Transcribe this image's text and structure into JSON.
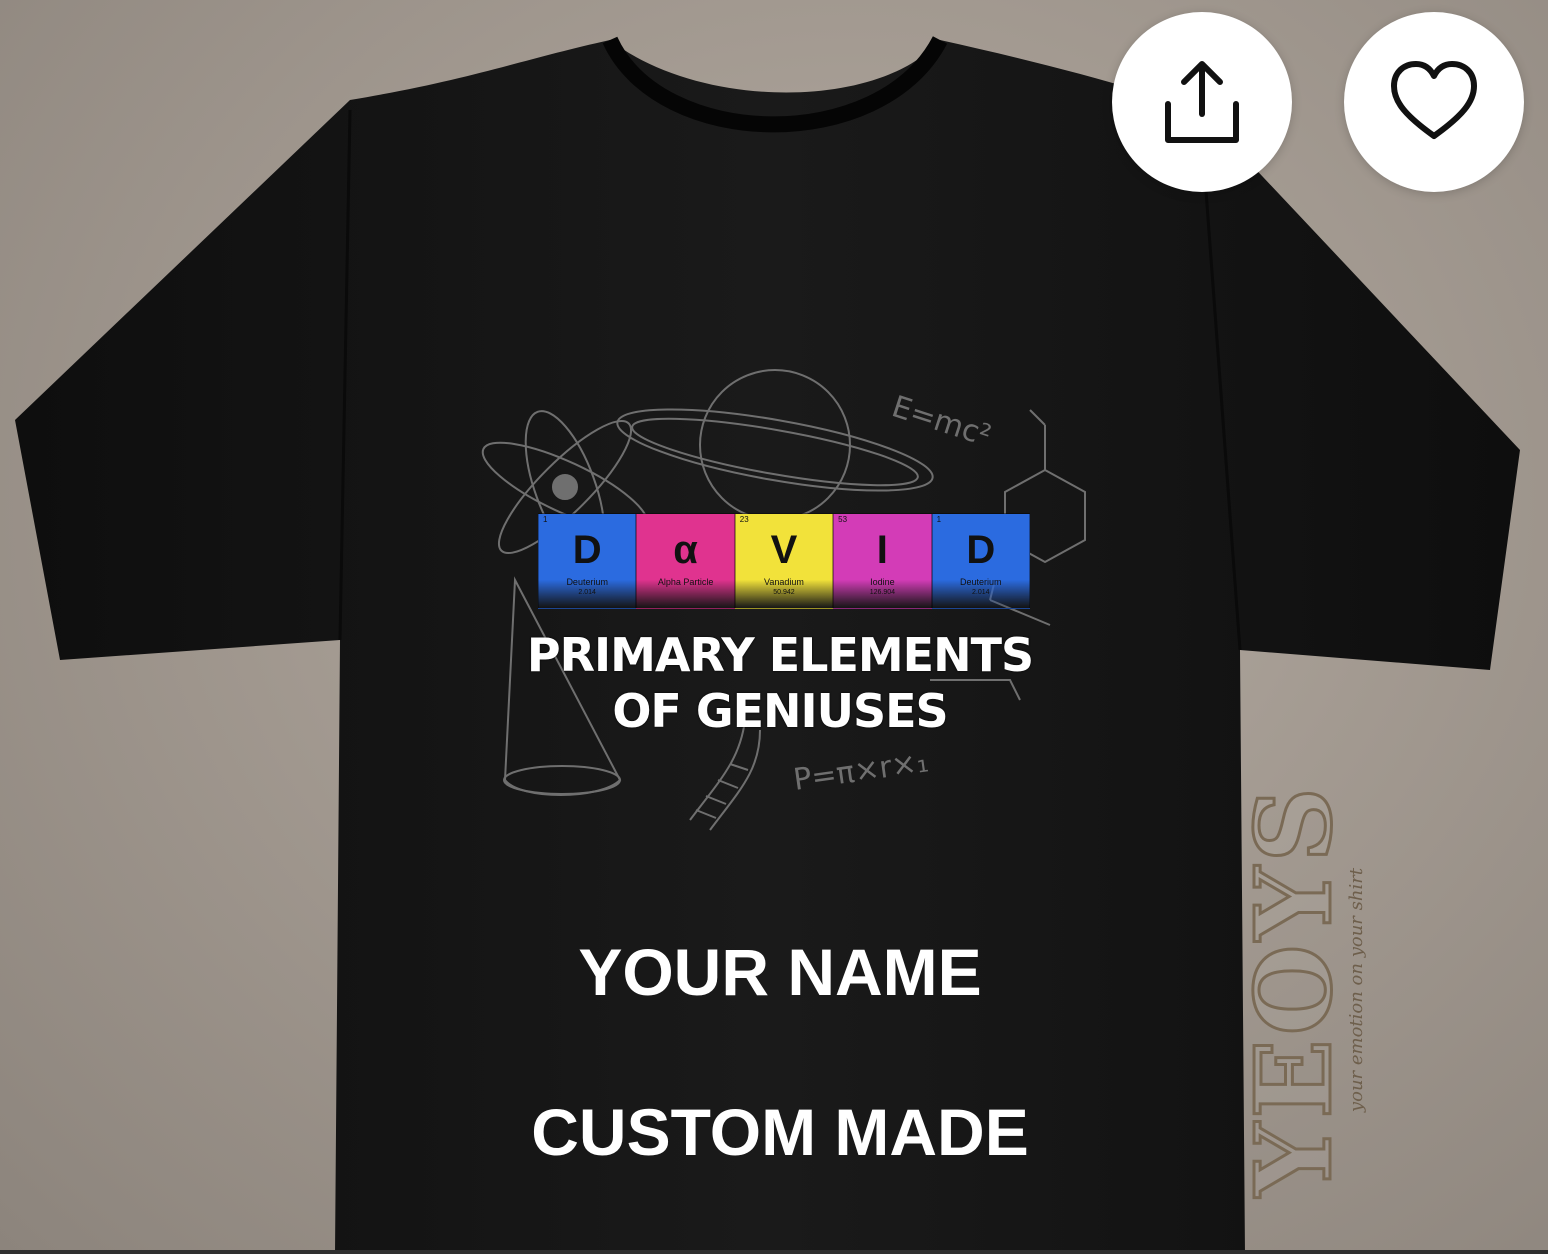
{
  "product": {
    "design": {
      "tiles": [
        {
          "number": "1",
          "symbol": "D",
          "name": "Deuterium",
          "weight": "2.014",
          "color": "#2b6be0"
        },
        {
          "number": "",
          "symbol": "α",
          "name": "Alpha Particle",
          "weight": "",
          "color": "#e0338f"
        },
        {
          "number": "23",
          "symbol": "V",
          "name": "Vanadium",
          "weight": "50.942",
          "color": "#f2e23a"
        },
        {
          "number": "53",
          "symbol": "I",
          "name": "Iodine",
          "weight": "126.904",
          "color": "#d33cb7"
        },
        {
          "number": "1",
          "symbol": "D",
          "name": "Deuterium",
          "weight": "2.014",
          "color": "#2b6be0"
        }
      ],
      "headline_line1": "PRIMARY ELEMENTS",
      "headline_line2": "OF GENIUSES",
      "formula_1": "E=mc²",
      "formula_2": "P=π×r×₁"
    },
    "print_line1": "YOUR NAME",
    "print_line2": "CUSTOM MADE",
    "watermark": {
      "brand": "YEOYS",
      "tagline": "your emotion on your shirt"
    }
  },
  "actions": {
    "share_icon": "share-icon",
    "favorite_icon": "heart-icon"
  },
  "colors": {
    "shirt": "#131313",
    "background": "#a39a91",
    "button": "#ffffff"
  }
}
